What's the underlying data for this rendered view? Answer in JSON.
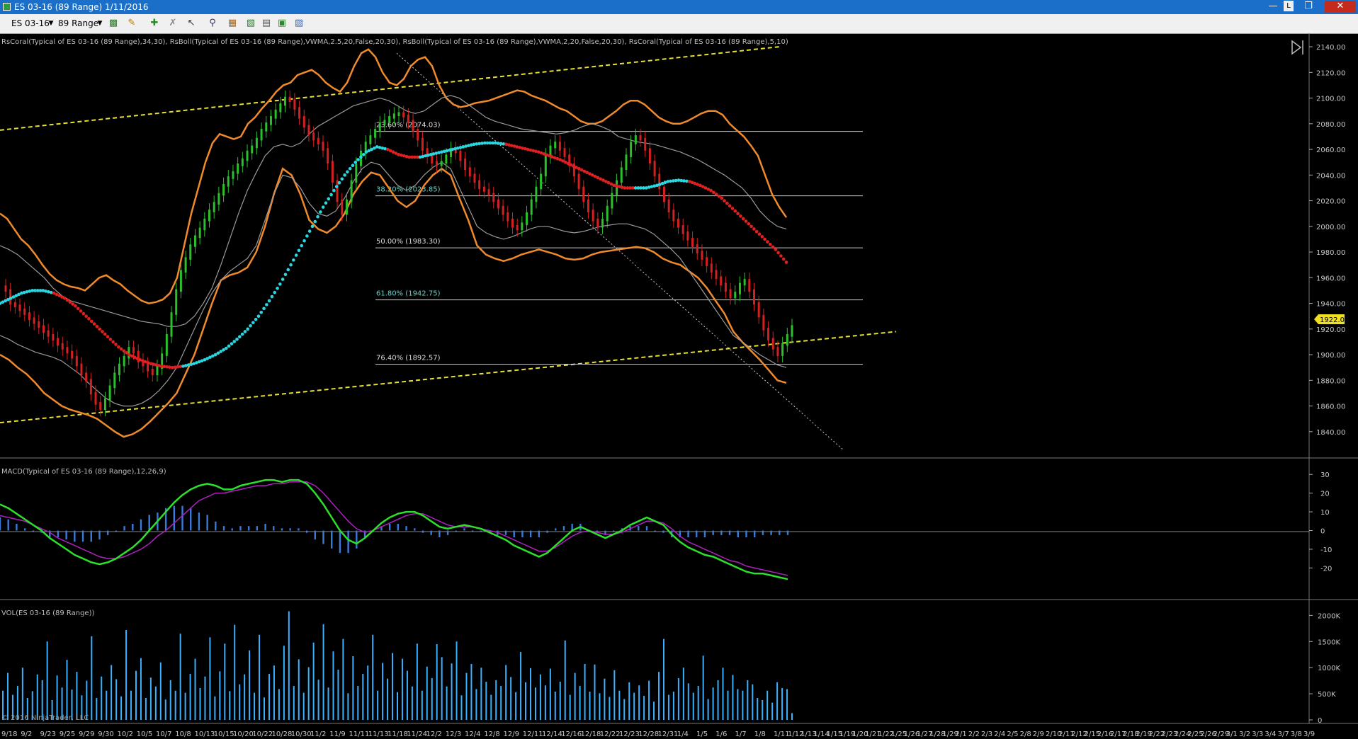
{
  "window": {
    "title": "ES 03-16 (89 Range)  1/11/2016",
    "controls": [
      "—",
      "L",
      "❐",
      "✕"
    ]
  },
  "toolbar": {
    "instrument": "ES 03-16",
    "interval": "89 Range"
  },
  "panels": {
    "price_label": "RsCoral(Typical of ES 03-16 (89 Range),34,30), RsBoll(Typical of ES 03-16 (89 Range),VWMA,2.5,20,False,20,30), RsBoll(Typical of ES 03-16 (89 Range),VWMA,2,20,False,20,30), RsCoral(Typical of ES 03-16 (89 Range),5,10)",
    "macd_label": "MACD(Typical of ES 03-16 (89 Range),12,26,9)",
    "vol_label": "VOL(ES 03-16 (89 Range))",
    "copyright": "© 2016 NinjaTrader, LLC",
    "last_price": "1922.00"
  },
  "colors": {
    "bull_bar": "#2bbf2b",
    "bear_bar": "#d42020",
    "band_outer": "#f08a2a",
    "band_inner": "#9a9a9a",
    "coral_slow_up": "#2ad7e0",
    "coral_slow_down": "#e02020",
    "coral_fast": "#e02020",
    "fib": "#c8c8c8",
    "trend": "#e8e030",
    "macd": "#2ce02c",
    "signal": "#b020c0",
    "hist": "#3a7ad8",
    "volume": "#3ab0ff"
  },
  "chart_data": [
    {
      "type": "line",
      "name": "price",
      "ylim": [
        1825,
        2145
      ],
      "yticks": [
        2140,
        2120,
        2100,
        2080,
        2060,
        2040,
        2020,
        2000,
        1980,
        1960,
        1940,
        1920,
        1900,
        1880,
        1860,
        1840
      ],
      "ytick_labels": [
        "2140.00",
        "2120.00",
        "2100.00",
        "2080.00",
        "2060.00",
        "2040.00",
        "2020.00",
        "2000.00",
        "1980.00",
        "1960.00",
        "1940.00",
        "1920.00",
        "1900.00",
        "1880.00",
        "1860.00",
        "1840.00"
      ],
      "close": [
        1950,
        1940,
        1938,
        1935,
        1932,
        1928,
        1925,
        1922,
        1918,
        1915,
        1912,
        1908,
        1905,
        1902,
        1898,
        1892,
        1885,
        1880,
        1870,
        1862,
        1858,
        1865,
        1875,
        1885,
        1892,
        1898,
        1905,
        1902,
        1895,
        1892,
        1888,
        1885,
        1890,
        1900,
        1915,
        1932,
        1950,
        1965,
        1975,
        1985,
        1992,
        1998,
        2005,
        2012,
        2018,
        2025,
        2032,
        2038,
        2042,
        2048,
        2052,
        2058,
        2062,
        2068,
        2075,
        2080,
        2085,
        2090,
        2095,
        2100,
        2098,
        2092,
        2085,
        2078,
        2072,
        2068,
        2065,
        2060,
        2050,
        2035,
        2020,
        2010,
        2020,
        2035,
        2048,
        2058,
        2065,
        2070,
        2075,
        2080,
        2082,
        2085,
        2087,
        2088,
        2086,
        2082,
        2075,
        2068,
        2060,
        2055,
        2050,
        2048,
        2050,
        2055,
        2060,
        2058,
        2052,
        2045,
        2040,
        2035,
        2030,
        2028,
        2025,
        2020,
        2015,
        2010,
        2005,
        2000,
        1998,
        2002,
        2010,
        2020,
        2030,
        2040,
        2055,
        2062,
        2065,
        2060,
        2055,
        2048,
        2040,
        2030,
        2020,
        2012,
        2005,
        2000,
        2005,
        2015,
        2025,
        2035,
        2045,
        2055,
        2065,
        2070,
        2068,
        2060,
        2050,
        2040,
        2030,
        2020,
        2012,
        2005,
        2000,
        1995,
        1990,
        1985,
        1980,
        1975,
        1970,
        1965,
        1960,
        1955,
        1950,
        1945,
        1948,
        1955,
        1958,
        1950,
        1940,
        1930,
        1920,
        1912,
        1905,
        1900,
        1908,
        1915,
        1922
      ],
      "outer_upper": [
        2010,
        2006,
        1998,
        1990,
        1985,
        1978,
        1970,
        1963,
        1958,
        1955,
        1953,
        1952,
        1950,
        1955,
        1960,
        1962,
        1958,
        1955,
        1950,
        1946,
        1942,
        1940,
        1941,
        1943,
        1948,
        1960,
        1985,
        2010,
        2030,
        2050,
        2065,
        2072,
        2070,
        2068,
        2070,
        2080,
        2085,
        2092,
        2098,
        2105,
        2110,
        2112,
        2118,
        2120,
        2122,
        2118,
        2112,
        2108,
        2105,
        2112,
        2125,
        2135,
        2138,
        2132,
        2120,
        2112,
        2110,
        2115,
        2125,
        2130,
        2132,
        2125,
        2110,
        2100,
        2095,
        2093,
        2094,
        2096,
        2097,
        2098,
        2100,
        2102,
        2104,
        2106,
        2105,
        2102,
        2100,
        2098,
        2095,
        2092,
        2090,
        2086,
        2082,
        2080,
        2080,
        2082,
        2086,
        2090,
        2095,
        2098,
        2098,
        2095,
        2090,
        2085,
        2082,
        2080,
        2080,
        2082,
        2085,
        2088,
        2090,
        2090,
        2087,
        2080,
        2075,
        2070,
        2063,
        2055,
        2040,
        2025,
        2015,
        2007
      ],
      "outer_lower": [
        1900,
        1896,
        1890,
        1885,
        1878,
        1870,
        1865,
        1860,
        1857,
        1855,
        1853,
        1850,
        1845,
        1840,
        1836,
        1838,
        1842,
        1848,
        1855,
        1862,
        1870,
        1885,
        1900,
        1920,
        1940,
        1958,
        1962,
        1964,
        1968,
        1980,
        2000,
        2025,
        2045,
        2040,
        2025,
        2005,
        1998,
        1995,
        2000,
        2010,
        2025,
        2035,
        2042,
        2040,
        2030,
        2020,
        2015,
        2020,
        2032,
        2040,
        2045,
        2040,
        2022,
        2005,
        1985,
        1978,
        1975,
        1973,
        1975,
        1978,
        1980,
        1982,
        1980,
        1978,
        1975,
        1974,
        1975,
        1978,
        1980,
        1981,
        1982,
        1983,
        1984,
        1983,
        1980,
        1975,
        1972,
        1970,
        1965,
        1960,
        1952,
        1942,
        1932,
        1918,
        1910,
        1903,
        1896,
        1888,
        1880,
        1878
      ],
      "inner_upper": [
        1985,
        1982,
        1978,
        1972,
        1966,
        1960,
        1952,
        1946,
        1942,
        1940,
        1938,
        1936,
        1934,
        1932,
        1930,
        1928,
        1926,
        1925,
        1924,
        1922,
        1922,
        1924,
        1930,
        1940,
        1952,
        1970,
        1990,
        2010,
        2028,
        2042,
        2055,
        2062,
        2064,
        2062,
        2065,
        2072,
        2078,
        2082,
        2086,
        2090,
        2094,
        2096,
        2098,
        2100,
        2098,
        2094,
        2090,
        2088,
        2090,
        2095,
        2100,
        2102,
        2100,
        2095,
        2090,
        2085,
        2082,
        2080,
        2078,
        2076,
        2075,
        2074,
        2073,
        2072,
        2073,
        2075,
        2078,
        2080,
        2078,
        2075,
        2070,
        2068,
        2066,
        2065,
        2064,
        2062,
        2060,
        2058,
        2055,
        2052,
        2048,
        2044,
        2040,
        2035,
        2030,
        2022,
        2012,
        2005,
        2000,
        1998
      ],
      "inner_lower": [
        1915,
        1912,
        1908,
        1905,
        1902,
        1900,
        1898,
        1895,
        1890,
        1885,
        1878,
        1872,
        1866,
        1862,
        1860,
        1860,
        1862,
        1866,
        1872,
        1880,
        1890,
        1905,
        1920,
        1935,
        1948,
        1958,
        1965,
        1970,
        1975,
        1985,
        2005,
        2025,
        2040,
        2038,
        2030,
        2018,
        2010,
        2008,
        2012,
        2022,
        2035,
        2045,
        2050,
        2048,
        2040,
        2032,
        2028,
        2032,
        2040,
        2046,
        2050,
        2045,
        2030,
        2015,
        2000,
        1995,
        1992,
        1990,
        1992,
        1995,
        1998,
        2000,
        2000,
        1998,
        1996,
        1995,
        1996,
        1998,
        2000,
        2001,
        2002,
        2002,
        2000,
        1998,
        1994,
        1988,
        1982,
        1975,
        1965,
        1955,
        1945,
        1935,
        1925,
        1915,
        1910,
        1905,
        1900,
        1896,
        1892,
        1890
      ],
      "coral_slow": [
        1940,
        1944,
        1948,
        1950,
        1950,
        1948,
        1944,
        1938,
        1930,
        1922,
        1914,
        1906,
        1900,
        1896,
        1893,
        1891,
        1890,
        1891,
        1893,
        1896,
        1900,
        1905,
        1912,
        1920,
        1930,
        1942,
        1955,
        1970,
        1985,
        2000,
        2015,
        2028,
        2040,
        2050,
        2058,
        2062,
        2060,
        2056,
        2054,
        2054,
        2056,
        2058,
        2060,
        2062,
        2064,
        2065,
        2065,
        2064,
        2062,
        2060,
        2058,
        2055,
        2052,
        2048,
        2044,
        2040,
        2036,
        2032,
        2030,
        2030,
        2030,
        2032,
        2035,
        2036,
        2035,
        2032,
        2028,
        2022,
        2014,
        2006,
        1998,
        1990,
        1982,
        1972
      ],
      "fib": [
        {
          "label": "23.60% (2074.03)",
          "value": 2074.03
        },
        {
          "label": "38.20% (2023.85)",
          "value": 2023.85
        },
        {
          "label": "50.00% (1983.30)",
          "value": 1983.3
        },
        {
          "label": "61.80% (1942.75)",
          "value": 1942.75
        },
        {
          "label": "76.40% (1892.57)",
          "value": 1892.57
        }
      ]
    },
    {
      "type": "line",
      "name": "MACD",
      "ylim": [
        -35,
        35
      ],
      "yticks": [
        30,
        20,
        10,
        0,
        -10,
        -20
      ],
      "ytick_labels": [
        "30",
        "20",
        "10",
        "0",
        "-10",
        "-20"
      ],
      "macd": [
        14,
        12,
        9,
        6,
        3,
        0,
        -4,
        -7,
        -10,
        -13,
        -15,
        -17,
        -18,
        -17,
        -15,
        -12,
        -9,
        -5,
        0,
        5,
        10,
        15,
        19,
        22,
        24,
        25,
        24,
        22,
        22,
        24,
        25,
        26,
        27,
        27,
        26,
        27,
        27,
        25,
        20,
        14,
        7,
        0,
        -5,
        -7,
        -4,
        0,
        4,
        7,
        9,
        10,
        10,
        8,
        5,
        2,
        1,
        2,
        3,
        2,
        1,
        -1,
        -3,
        -5,
        -8,
        -10,
        -12,
        -14,
        -12,
        -8,
        -4,
        0,
        2,
        0,
        -2,
        -4,
        -2,
        0,
        3,
        5,
        7,
        5,
        3,
        -2,
        -6,
        -9,
        -11,
        -13,
        -14,
        -16,
        -18,
        -20,
        -22,
        -23,
        -23,
        -24,
        -25,
        -26
      ],
      "signal": [
        8,
        7,
        6,
        5,
        3,
        1,
        -1,
        -4,
        -6,
        -8,
        -10,
        -12,
        -14,
        -15,
        -15,
        -14,
        -12,
        -10,
        -7,
        -3,
        0,
        4,
        8,
        12,
        16,
        18,
        20,
        20,
        21,
        22,
        23,
        24,
        24,
        25,
        25,
        26,
        26,
        26,
        24,
        20,
        15,
        10,
        5,
        1,
        -1,
        0,
        2,
        4,
        6,
        8,
        9,
        9,
        7,
        5,
        3,
        2,
        2,
        2,
        1,
        0,
        -1,
        -3,
        -5,
        -7,
        -9,
        -11,
        -11,
        -9,
        -6,
        -3,
        -1,
        0,
        -1,
        -2,
        -2,
        -1,
        1,
        3,
        5,
        5,
        4,
        1,
        -3,
        -6,
        -8,
        -10,
        -12,
        -14,
        -16,
        -17,
        -19,
        -20,
        -21,
        -22,
        -23,
        -24
      ]
    },
    {
      "type": "bar",
      "name": "VOL",
      "ylim": [
        0,
        2100
      ],
      "yticks": [
        2000,
        1500,
        1000,
        500,
        0
      ],
      "ytick_labels": [
        "2000K",
        "1500K",
        "1000K",
        "500K",
        "0"
      ],
      "values": [
        560,
        900,
        480,
        650,
        1000,
        420,
        550,
        870,
        760,
        1500,
        380,
        850,
        620,
        1150,
        580,
        920,
        470,
        750,
        1600,
        420,
        830,
        560,
        1050,
        780,
        450,
        1720,
        560,
        940,
        1180,
        420,
        810,
        640,
        1100,
        390,
        760,
        560,
        1650,
        520,
        880,
        1170,
        610,
        830,
        1580,
        450,
        930,
        1460,
        550,
        1820,
        680,
        870,
        1330,
        520,
        1630,
        430,
        880,
        1040,
        590,
        1420,
        2080,
        650,
        1160,
        520,
        1010,
        1480,
        770,
        1830,
        620,
        1310,
        960,
        1550,
        510,
        1220,
        650,
        880,
        1040,
        1630,
        560,
        1090,
        790,
        1280,
        530,
        1170,
        940,
        640,
        1460,
        560,
        1020,
        800,
        1450,
        1200,
        640,
        1080,
        1500,
        470,
        900,
        1070,
        590,
        1000,
        730,
        480,
        760,
        650,
        1050,
        820,
        530,
        1300,
        720,
        990,
        620,
        870,
        660,
        980,
        540,
        730,
        1520,
        480,
        900,
        650,
        1070,
        540,
        1060,
        510,
        790,
        440,
        950,
        560,
        400,
        720,
        520,
        660,
        460,
        750,
        350,
        920,
        1550,
        480,
        540,
        800,
        1000,
        700,
        520,
        650,
        1230,
        400,
        620,
        760,
        1000,
        560,
        860,
        590,
        560,
        760,
        680,
        420,
        380,
        560,
        330,
        720,
        610,
        590,
        130
      ],
      "x_labels": [
        "9/18",
        "9/2",
        "9/23",
        "9/25",
        "9/29",
        "9/30",
        "10/2",
        "10/5",
        "10/7",
        "10/8",
        "10/13",
        "10/15",
        "10/20",
        "10/22",
        "10/28",
        "10/30",
        "11/2",
        "11/9",
        "11/11",
        "11/13",
        "11/18",
        "11/24",
        "12/2",
        "12/3",
        "12/4",
        "12/8",
        "12/9",
        "12/11",
        "12/14",
        "12/16",
        "12/18",
        "12/22",
        "12/23",
        "12/28",
        "12/31",
        "1/4",
        "1/5",
        "1/6",
        "1/7",
        "1/8",
        "1/11",
        "1/12",
        "1/13",
        "1/14",
        "1/15",
        "1/19",
        "1/20",
        "1/21",
        "1/22",
        "1/25",
        "1/26",
        "1/27",
        "1/28",
        "1/29",
        "2/1",
        "2/2",
        "2/3",
        "2/4",
        "2/5",
        "2/8",
        "2/9",
        "2/10",
        "2/11",
        "2/12",
        "2/15",
        "2/16",
        "2/17",
        "2/18",
        "2/19",
        "2/22",
        "2/23",
        "2/24",
        "2/25",
        "2/26",
        "2/29",
        "3/1",
        "3/2",
        "3/3",
        "3/4",
        "3/7",
        "3/8",
        "3/9"
      ]
    }
  ]
}
